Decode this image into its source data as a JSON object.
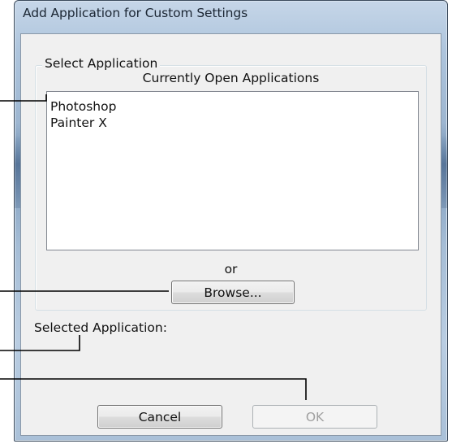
{
  "dialog": {
    "title": "Add Application for Custom Settings"
  },
  "select_group": {
    "legend": "Select Application",
    "list_caption": "Currently Open Applications",
    "applications": [
      "Photoshop",
      "Painter X"
    ],
    "or_label": "or",
    "browse_label": "Browse..."
  },
  "selected": {
    "label": "Selected Application:"
  },
  "footer": {
    "cancel_label": "Cancel",
    "ok_label": "OK",
    "ok_enabled": false
  },
  "colors": {
    "callout_line": "#000000",
    "dialog_face": "#f0f0f0",
    "disabled_text": "#a0a0a0"
  }
}
